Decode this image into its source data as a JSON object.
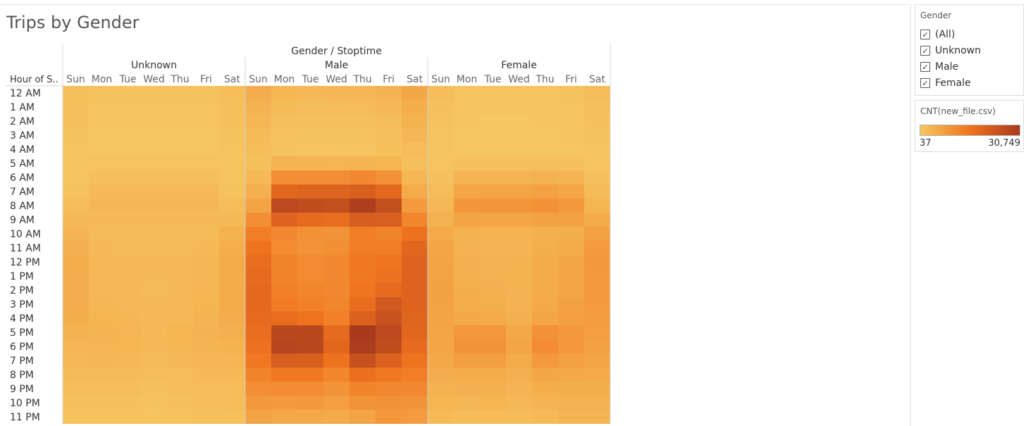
{
  "page": {
    "title": "Trips by Gender"
  },
  "chart_data": {
    "type": "heatmap",
    "title": "Trips by Gender",
    "column_header": "Gender / Stoptime",
    "row_header": "Hour of S..",
    "groups": [
      "Unknown",
      "Male",
      "Female"
    ],
    "days": [
      "Sun",
      "Mon",
      "Tue",
      "Wed",
      "Thu",
      "Fri",
      "Sat"
    ],
    "hours": [
      "12 AM",
      "1 AM",
      "2 AM",
      "3 AM",
      "4 AM",
      "5 AM",
      "6 AM",
      "7 AM",
      "8 AM",
      "9 AM",
      "10 AM",
      "11 AM",
      "12 PM",
      "1 PM",
      "2 PM",
      "3 PM",
      "4 PM",
      "5 PM",
      "6 PM",
      "7 PM",
      "8 PM",
      "9 PM",
      "10 PM",
      "11 PM"
    ],
    "color_measure": "CNT(new_file.csv)",
    "color_range": [
      37,
      30749
    ],
    "color_scale": [
      "#f6c760",
      "#f0731e",
      "#a83a1e"
    ],
    "values": {
      "Unknown": [
        [
          1500,
          1000,
          900,
          900,
          900,
          1000,
          1600
        ],
        [
          1400,
          700,
          600,
          600,
          600,
          700,
          1400
        ],
        [
          1200,
          500,
          400,
          400,
          400,
          500,
          1200
        ],
        [
          1000,
          300,
          200,
          200,
          200,
          300,
          1000
        ],
        [
          700,
          300,
          200,
          200,
          200,
          300,
          700
        ],
        [
          500,
          700,
          700,
          700,
          700,
          700,
          500
        ],
        [
          600,
          1500,
          1500,
          1500,
          1500,
          1400,
          700
        ],
        [
          1000,
          2500,
          2500,
          2500,
          2500,
          2400,
          1000
        ],
        [
          1600,
          3000,
          3000,
          3000,
          3000,
          2900,
          1600
        ],
        [
          2600,
          2500,
          2500,
          2500,
          2500,
          2500,
          2600
        ],
        [
          3600,
          2200,
          2200,
          2200,
          2200,
          2200,
          3700
        ],
        [
          4200,
          2400,
          2300,
          2300,
          2300,
          2600,
          4600
        ],
        [
          4600,
          2700,
          2600,
          2500,
          2600,
          3000,
          4900
        ],
        [
          4800,
          2700,
          2600,
          2400,
          2500,
          3000,
          5000
        ],
        [
          4800,
          2800,
          2700,
          2300,
          2500,
          3100,
          5000
        ],
        [
          4700,
          2900,
          2800,
          2400,
          2600,
          3200,
          4900
        ],
        [
          4500,
          3200,
          3000,
          2500,
          2800,
          3500,
          4700
        ],
        [
          4000,
          3600,
          3400,
          2600,
          3200,
          3800,
          4300
        ],
        [
          3400,
          3400,
          3200,
          2500,
          3000,
          3600,
          3700
        ],
        [
          2800,
          2900,
          2700,
          2200,
          2600,
          3100,
          3100
        ],
        [
          2200,
          2300,
          2200,
          1800,
          2100,
          2600,
          2500
        ],
        [
          1700,
          1700,
          1600,
          1300,
          1600,
          2000,
          2100
        ],
        [
          1300,
          1200,
          1200,
          1000,
          1100,
          1700,
          1800
        ],
        [
          1000,
          900,
          900,
          800,
          900,
          1500,
          1500
        ]
      ],
      "Male": [
        [
          4800,
          3200,
          2800,
          2900,
          3000,
          3800,
          5800
        ],
        [
          3800,
          2200,
          1800,
          1900,
          2000,
          2700,
          4600
        ],
        [
          3000,
          1500,
          1200,
          1300,
          1400,
          1900,
          3700
        ],
        [
          2300,
          1000,
          900,
          900,
          900,
          1300,
          2900
        ],
        [
          1600,
          900,
          800,
          800,
          800,
          1100,
          2000
        ],
        [
          1300,
          3500,
          3500,
          3400,
          3500,
          3200,
          1500
        ],
        [
          2500,
          10500,
          10500,
          10200,
          11500,
          10000,
          3000
        ],
        [
          4300,
          18500,
          19500,
          19500,
          20500,
          18000,
          5000
        ],
        [
          6500,
          26500,
          25500,
          25000,
          29500,
          25000,
          8000
        ],
        [
          10500,
          19500,
          17500,
          17000,
          21000,
          20500,
          12000
        ],
        [
          13500,
          11500,
          10000,
          9500,
          13500,
          12500,
          16000
        ],
        [
          15500,
          11000,
          9500,
          10500,
          13500,
          13500,
          18500
        ],
        [
          17000,
          12500,
          11000,
          11500,
          14500,
          15000,
          19500
        ],
        [
          17500,
          12500,
          11000,
          11500,
          14500,
          16000,
          19500
        ],
        [
          18000,
          13000,
          12000,
          11500,
          15000,
          17500,
          19500
        ],
        [
          18000,
          14000,
          13000,
          12000,
          17000,
          22000,
          19500
        ],
        [
          17500,
          17000,
          15500,
          13000,
          20000,
          24000,
          19000
        ],
        [
          17000,
          27000,
          27000,
          17500,
          30749,
          26500,
          18500
        ],
        [
          16000,
          27500,
          27000,
          18500,
          30000,
          25500,
          17500
        ],
        [
          14500,
          21000,
          20500,
          15500,
          24500,
          20000,
          15500
        ],
        [
          12500,
          14500,
          14500,
          12000,
          16500,
          14500,
          13500
        ],
        [
          10500,
          11000,
          11000,
          9500,
          12500,
          11500,
          11500
        ],
        [
          8500,
          8000,
          8500,
          7500,
          9500,
          10000,
          9500
        ],
        [
          6500,
          5500,
          5500,
          5000,
          6500,
          8500,
          8000
        ]
      ],
      "Female": [
        [
          1600,
          800,
          700,
          700,
          800,
          1000,
          1900
        ],
        [
          1300,
          600,
          500,
          500,
          600,
          800,
          1500
        ],
        [
          1000,
          400,
          300,
          300,
          400,
          600,
          1200
        ],
        [
          800,
          300,
          200,
          200,
          300,
          400,
          900
        ],
        [
          500,
          300,
          200,
          200,
          200,
          300,
          600
        ],
        [
          600,
          1200,
          1200,
          1100,
          1200,
          1100,
          700
        ],
        [
          1100,
          3500,
          3600,
          3500,
          4000,
          3500,
          1300
        ],
        [
          1900,
          6000,
          6500,
          6500,
          7000,
          6000,
          2200
        ],
        [
          2800,
          9000,
          9000,
          9000,
          10000,
          8500,
          3200
        ],
        [
          4000,
          6500,
          6000,
          6000,
          7000,
          7000,
          5000
        ],
        [
          5300,
          3800,
          3500,
          3500,
          4300,
          4500,
          7000
        ],
        [
          6000,
          3800,
          3500,
          3500,
          4500,
          5000,
          8000
        ],
        [
          6500,
          4200,
          4000,
          4000,
          5000,
          5800,
          8500
        ],
        [
          6700,
          4300,
          4000,
          3900,
          5000,
          6000,
          8300
        ],
        [
          6800,
          4400,
          4200,
          3800,
          5000,
          6300,
          8200
        ],
        [
          6700,
          4600,
          4400,
          3800,
          5300,
          6800,
          8000
        ],
        [
          6500,
          5600,
          5300,
          4300,
          6300,
          7500,
          7800
        ],
        [
          6300,
          8800,
          8800,
          5500,
          10000,
          8500,
          7500
        ],
        [
          6000,
          9500,
          9500,
          6000,
          11000,
          8800,
          7000
        ],
        [
          5500,
          7500,
          7500,
          5200,
          8500,
          7200,
          6300
        ],
        [
          4800,
          5200,
          5200,
          4300,
          5800,
          5500,
          5300
        ],
        [
          4000,
          4200,
          4200,
          3500,
          4600,
          4500,
          4500
        ],
        [
          3200,
          3000,
          3200,
          2800,
          3500,
          3800,
          3800
        ],
        [
          2500,
          2000,
          2100,
          2000,
          2500,
          3300,
          3300
        ]
      ]
    }
  },
  "filter": {
    "title": "Gender",
    "items": [
      {
        "label": "(All)",
        "checked": true
      },
      {
        "label": "Unknown",
        "checked": true
      },
      {
        "label": "Male",
        "checked": true
      },
      {
        "label": "Female",
        "checked": true
      }
    ]
  },
  "legend": {
    "title": "CNT(new_file.csv)",
    "min_label": "37",
    "max_label": "30,749"
  }
}
